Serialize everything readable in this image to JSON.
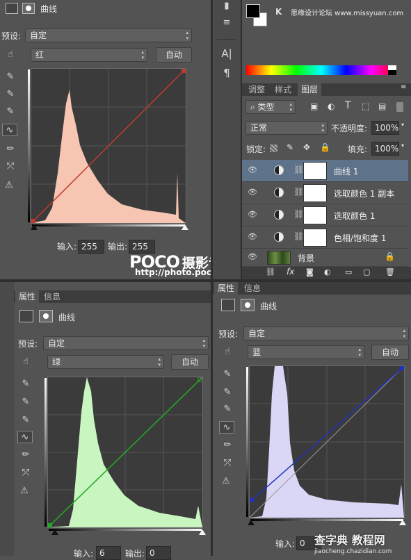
{
  "top_left": {
    "panel_title": "曲线",
    "preset_label": "预设:",
    "preset_value": "自定",
    "channel_value": "红",
    "auto_label": "自动",
    "input_label": "输入:",
    "input_value": "255",
    "output_label": "输出:",
    "output_value": "255",
    "curve_color": "#c0392b",
    "histogram_color": "#f6c6b2"
  },
  "watermark": {
    "brand": "POCO",
    "brand_cn": "摄影专题",
    "url": "http://photo.poco.cn/"
  },
  "top_strip": {
    "k_label": "K",
    "watermark_text": "思缘设计论坛 www.missyuan.com"
  },
  "layers_panel": {
    "tabs": [
      "调整",
      "样式",
      "图层"
    ],
    "filter_label": "类型",
    "blend_mode": "正常",
    "opacity_label": "不透明度:",
    "opacity_value": "100%",
    "lock_label": "锁定:",
    "fill_label": "填充:",
    "fill_value": "100%",
    "layers": [
      {
        "name": "曲线 1",
        "selected": true
      },
      {
        "name": "选取颜色 1 副本",
        "selected": false
      },
      {
        "name": "选取颜色 1",
        "selected": false
      },
      {
        "name": "色相/饱和度 1",
        "selected": false
      },
      {
        "name": "背景",
        "selected": false
      }
    ]
  },
  "bottom_left": {
    "tabs": [
      "属性",
      "信息"
    ],
    "panel_title": "曲线",
    "preset_label": "预设:",
    "preset_value": "自定",
    "channel_value": "绿",
    "auto_label": "自动",
    "input_label": "输入:",
    "input_value": "6",
    "output_label": "输出:",
    "output_value": "0",
    "curve_color": "#22aa22",
    "histogram_color": "#c8f5c0"
  },
  "bottom_right": {
    "tabs": [
      "属性",
      "信息"
    ],
    "panel_title": "曲线",
    "preset_label": "预设:",
    "preset_value": "自定",
    "channel_value": "蓝",
    "auto_label": "自动",
    "input_label": "输入:",
    "input_value": "0",
    "curve_color": "#2233bb",
    "histogram_color": "#d9d6f6"
  },
  "site_watermark": {
    "text": "查字典 教程网",
    "url": "jiaocheng.chazidian.com"
  }
}
